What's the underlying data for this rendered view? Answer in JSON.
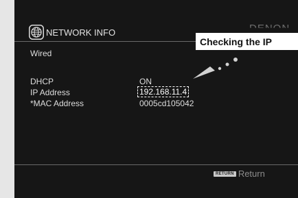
{
  "brand": "DENON",
  "header": {
    "title": "NETWORK INFO",
    "icon": "globe-icon"
  },
  "connection_type": "Wired",
  "callout": {
    "text": "Checking the IP"
  },
  "info": {
    "rows": [
      {
        "label": "DHCP",
        "value": "ON"
      },
      {
        "label": "IP Address",
        "value": "192.168.11.4"
      },
      {
        "label": "*MAC Address",
        "value": "0005cd105042"
      }
    ]
  },
  "footer": {
    "key_label": "RETURN",
    "action_label": "Return"
  },
  "colors": {
    "screen_bg": "#161616",
    "page_bg": "#e6e6e6",
    "callout_bg": "#ffffff"
  }
}
